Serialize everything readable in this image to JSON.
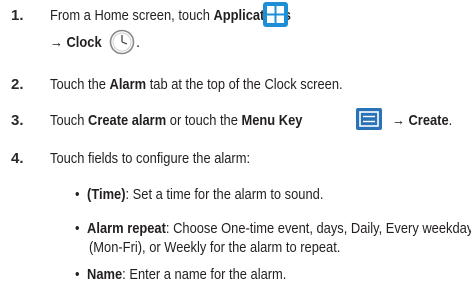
{
  "steps": [
    {
      "number": "1.",
      "line1_pre": "From a Home screen, touch ",
      "line1_bold": "Applications",
      "applications_icon": "apps-grid-icon",
      "line2_arrow": "→",
      "line2_bold": "Clock",
      "clock_icon": "clock-icon",
      "line2_post": "."
    },
    {
      "number": "2.",
      "pre": "Touch the ",
      "bold": "Alarm",
      "post": " tab at the top of the Clock screen."
    },
    {
      "number": "3.",
      "pre": "Touch ",
      "bold1": "Create alarm",
      "mid": " or touch the ",
      "bold2": "Menu Key",
      "menu_icon": "menu-key-icon",
      "arrow": "→",
      "bold3": "Create",
      "post": "."
    },
    {
      "number": "4.",
      "text": "Touch fields to configure the alarm:"
    }
  ],
  "bullets": [
    {
      "bold": "(Time)",
      "text": ": Set a time for the alarm to sound."
    },
    {
      "bold": "Alarm repeat",
      "text": ": Choose One-time event, days, Daily, Every weekday",
      "continuation": "(Mon-Fri), or Weekly for the alarm to repeat."
    },
    {
      "bold": "Name",
      "text": ": Enter a name for the alarm."
    }
  ],
  "colors": {
    "icon_blue": "#1e8fd6",
    "menu_key_blue": "#2b73b8",
    "text": "#231f20"
  }
}
